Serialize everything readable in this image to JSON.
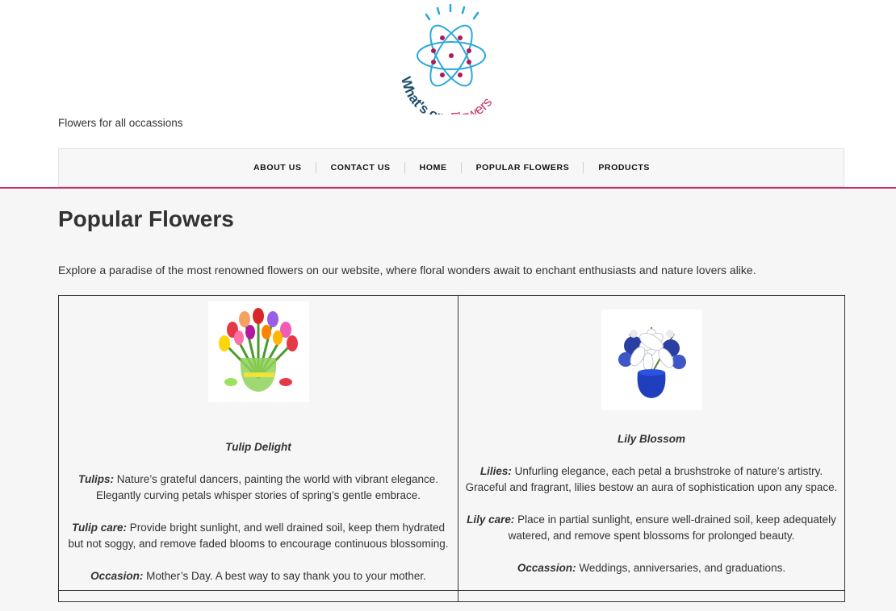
{
  "site": {
    "logo_text_part1": "What's on",
    "logo_text_part2": "Flowers",
    "tagline": "Flowers for all occassions"
  },
  "nav": {
    "items": [
      {
        "label": "ABOUT US"
      },
      {
        "label": "CONTACT US"
      },
      {
        "label": "HOME"
      },
      {
        "label": "POPULAR FLOWERS"
      },
      {
        "label": "PRODUCTS"
      }
    ]
  },
  "page": {
    "title": "Popular Flowers",
    "intro": "Explore a paradise of the most renowned flowers on our website, where floral wonders await to enchant enthusiasts and nature lovers alike."
  },
  "flowers": [
    {
      "name": "Tulip Delight",
      "desc_label": "Tulips:",
      "desc": " Nature’s grateful dancers, painting the world with vibrant elegance. Elegantly curving petals whisper stories of spring’s gentle embrace.",
      "care_label": "Tulip care:",
      "care": " Provide bright sunlight, and well drained soil, keep them hydrated but not soggy, and remove faded blooms to encourage continuous blossoming.",
      "occasion_label": "Occasion:",
      "occasion": " Mother’s Day. A best way to say thank you to your mother."
    },
    {
      "name": "Lily Blossom",
      "desc_label": "Lilies:",
      "desc": " Unfurling elegance, each petal a brushstroke of nature’s artistry. Graceful and fragrant, lilies bestow an aura of sophistication upon any space.",
      "care_label": "Lily care:",
      "care": " Place in partial sunlight, ensure well-drained soil, keep adequately watered, and remove spent blossoms for prolonged beauty.",
      "occasion_label": "Occassion:",
      "occasion": " Weddings, anniversaries, and graduations."
    }
  ],
  "colors": {
    "accent_pink": "#c5306c",
    "logo_blue": "#29a8dc",
    "logo_navy": "#1d4e6b"
  }
}
